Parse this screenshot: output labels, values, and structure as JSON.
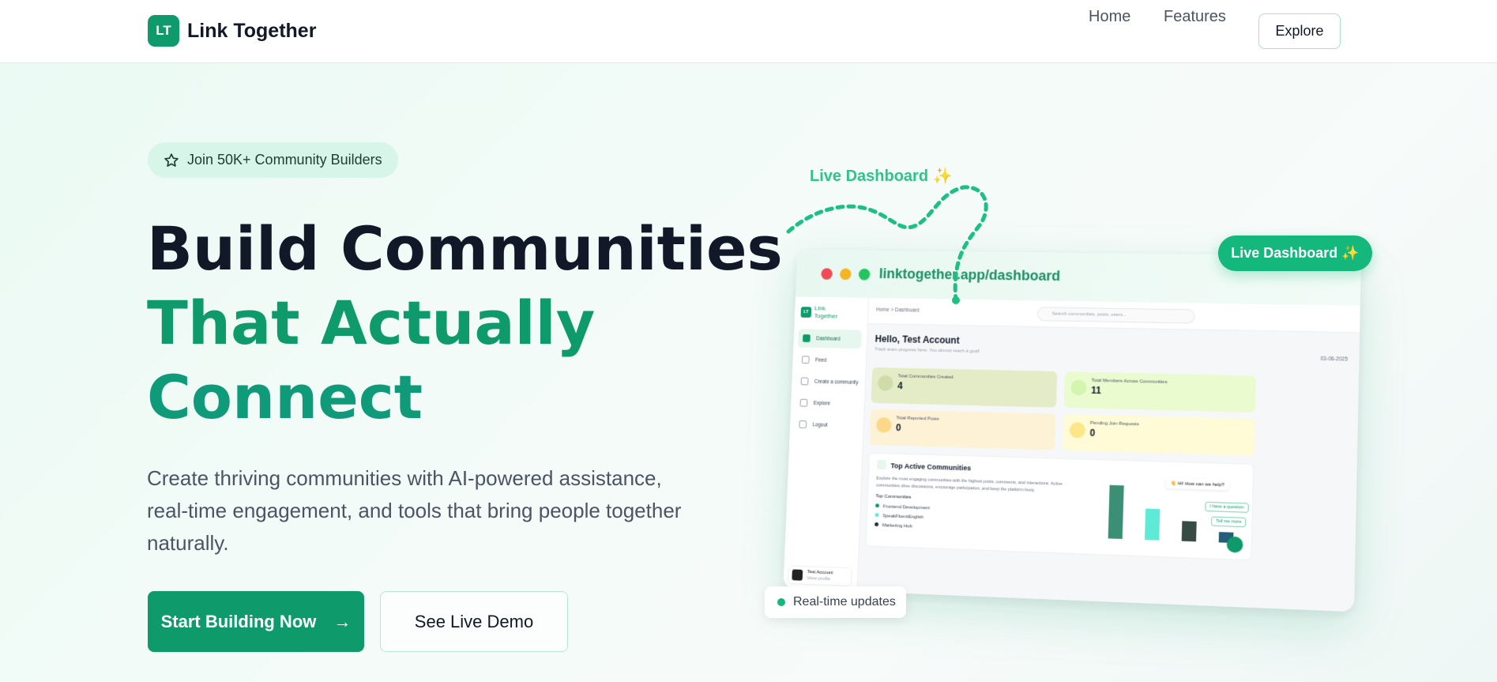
{
  "nav": {
    "logo_initials": "LT",
    "brand": "Link Together",
    "links": {
      "home": "Home",
      "features": "Features",
      "explore": "Explore"
    }
  },
  "hero": {
    "badge": "Join 50K+ Community Builders",
    "headline": [
      "Build Communities",
      "That Actually",
      "Connect"
    ],
    "subtitle": "Create thriving communities with AI-powered assistance, real-time engagement, and tools that bring people together naturally.",
    "primary_button": "Start Building Now",
    "secondary_button": "See Live Demo"
  },
  "preview": {
    "live_label": "Live Dashboard ✨",
    "live_pill": "Live Dashboard ✨",
    "realtime_pill": "Real-time updates",
    "url": "linktogether.app/dashboard",
    "sidebar": {
      "logo_initials": "LT",
      "logo_text": "Link Together",
      "items": [
        "Dashboard",
        "Feed",
        "Create a community",
        "Explore",
        "Logout"
      ],
      "user_name": "Test Account",
      "user_sub": "View profile"
    },
    "topbar": {
      "crumb": "Home  >  Dashboard",
      "search_placeholder": "Search communities, posts, users..."
    },
    "greeting": "Hello, Test Account",
    "greeting_sub": "Track team progress here. You almost reach a goal!",
    "date": "03-06-2025",
    "stats": [
      {
        "label": "Total Communities Created",
        "value": "4"
      },
      {
        "label": "Total Members Across Communities",
        "value": "11"
      },
      {
        "label": "Total Reported Posts",
        "value": "0"
      },
      {
        "label": "Pending Join Requests",
        "value": "0"
      }
    ],
    "panel": {
      "title": "Top Active Communities",
      "desc": "Explore the most engaging communities with the highest posts, comments, and interactions. Active communities drive discussions, encourage participation, and keep the platform lively.",
      "list_heading": "Top Communities",
      "list": [
        "Frontend Development",
        "SpeakFluentEnglish",
        "Marketing Hub"
      ],
      "chat_greeting": "👋 Hi! How can we help?",
      "chat_options": [
        "I have a question",
        "Tell me more"
      ],
      "bar_values": [
        0.95,
        0.55,
        0.35,
        0.18
      ]
    }
  },
  "colors": {
    "brand": "#0e9a6b",
    "accent": "#14b87c"
  }
}
